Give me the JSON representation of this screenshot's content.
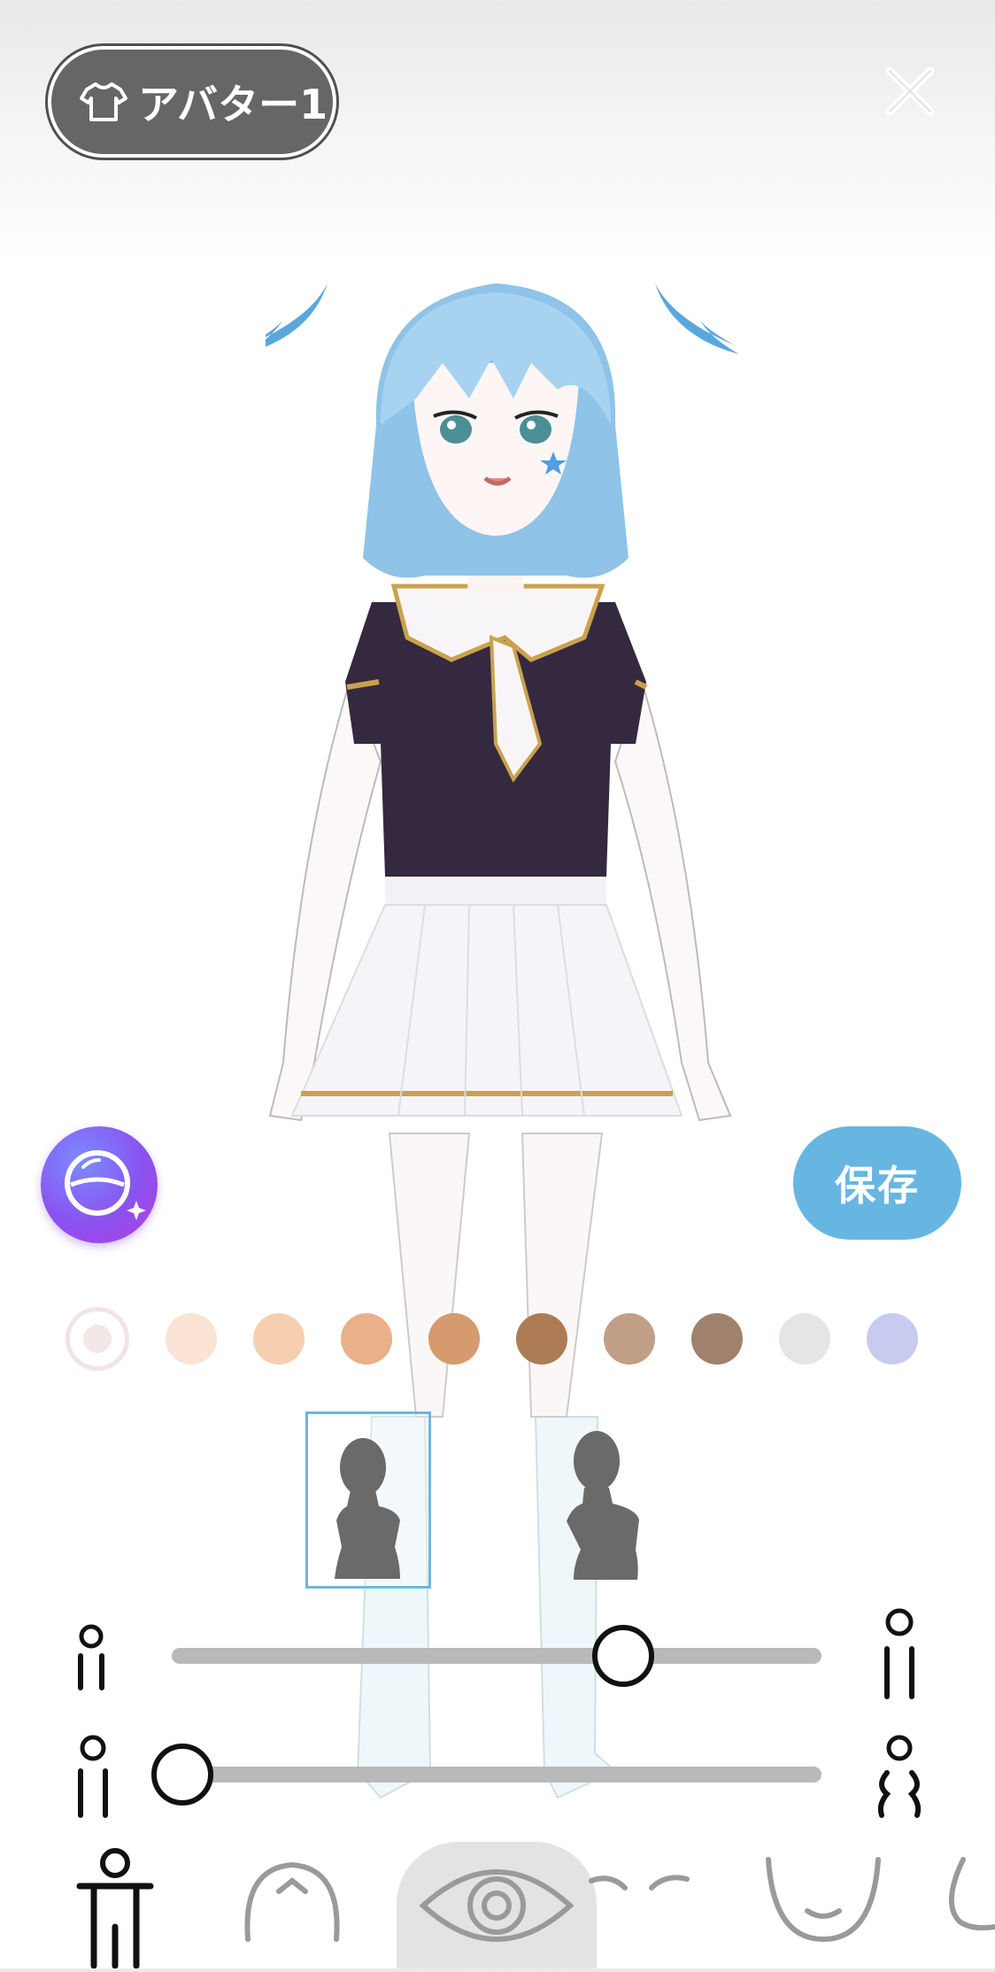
{
  "header": {
    "avatar_label": "アバター1",
    "avatar_icon": "tshirt-icon",
    "close_icon": "close-icon"
  },
  "actions": {
    "ai_icon": "ai-sparkle-icon",
    "save_label": "保存"
  },
  "skin_colors": {
    "selected_index": 0,
    "swatches": [
      "#ffffff",
      "#fbe3d5",
      "#f6cfb0",
      "#e9b089",
      "#d59a6d",
      "#ad7c55",
      "#c19f86",
      "#a0816b",
      "#e6e4e6",
      "#c7cbf0"
    ]
  },
  "body_types": {
    "selected_index": 0,
    "options": [
      "slim-body-type",
      "curvy-body-type"
    ]
  },
  "sliders": {
    "height": {
      "value": 0.7,
      "min_icon": "short-figure-icon",
      "max_icon": "tall-figure-icon"
    },
    "body_width": {
      "value": 0.0,
      "min_icon": "narrow-figure-icon",
      "max_icon": "wide-figure-icon"
    }
  },
  "bottom_tabs": {
    "active_index": 2,
    "items": [
      "body-tab-icon",
      "hair-tab-icon",
      "eye-tab-icon",
      "eyebrow-tab-icon",
      "face-shape-tab-icon",
      "mouth-tab-icon"
    ]
  },
  "colors": {
    "accent": "#67b6e2",
    "pill_bg": "#666666"
  }
}
